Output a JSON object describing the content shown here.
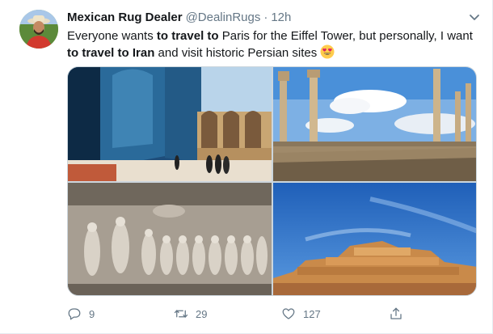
{
  "tweet": {
    "author_name": "Mexican Rug Dealer",
    "handle": "@DealinRugs",
    "separator": "·",
    "time": "12h",
    "text_parts": {
      "p1": "Everyone wants ",
      "b1": "to travel to",
      "p2": " Paris for the Eiffel Tower, but personally, I want ",
      "b2": "to travel to Iran",
      "p3": " and visit historic Persian sites"
    },
    "emoji": "heart-eyes-emoji"
  },
  "media": [
    {
      "label": "mosque-courtyard-photo"
    },
    {
      "label": "persepolis-ruins-photo"
    },
    {
      "label": "rock-relief-photo"
    },
    {
      "label": "ziggurat-photo"
    }
  ],
  "actions": {
    "reply_count": "9",
    "retweet_count": "29",
    "like_count": "127"
  },
  "colors": {
    "text": "#14171a",
    "secondary": "#657786",
    "border": "#ccd6dd"
  },
  "icons": [
    "chevron-down-icon",
    "reply-icon",
    "retweet-icon",
    "like-icon",
    "share-icon"
  ]
}
